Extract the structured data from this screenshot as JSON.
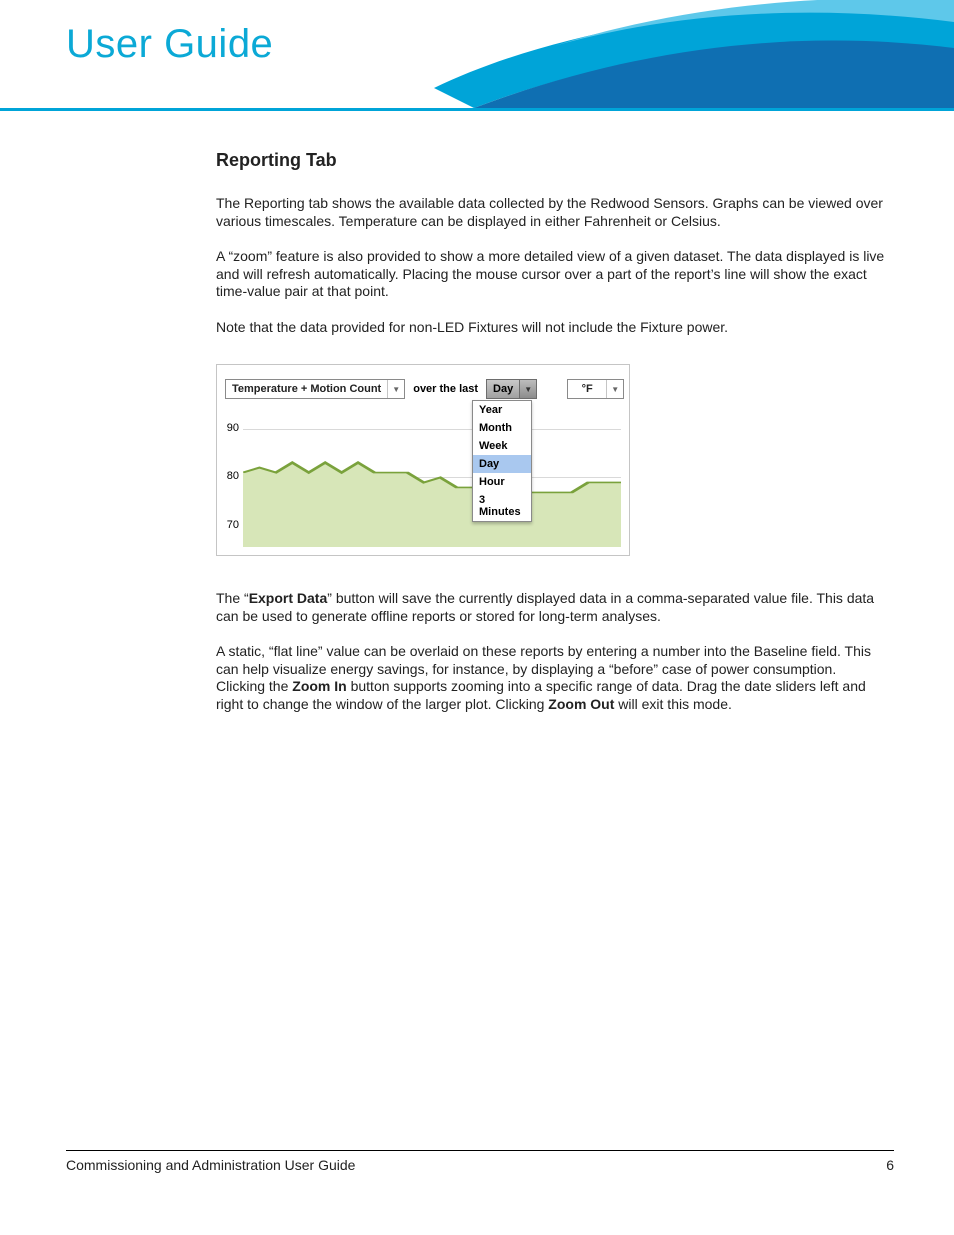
{
  "header": {
    "title": "User Guide"
  },
  "section": {
    "heading": "Reporting Tab"
  },
  "paragraphs": {
    "p1": "The Reporting tab shows the available data collected by the Redwood Sensors. Graphs can be viewed over various timescales. Temperature can be displayed in either Fahrenheit or Celsius.",
    "p2": "A “zoom” feature is also provided to show a more detailed view of a given dataset. The data displayed is live and will refresh automatically. Placing the mouse cursor over a part of the report’s line will show the exact time-value pair at that point.",
    "p3": "Note that the data provided for non-LED Fixtures will not include the Fixture power.",
    "p4_a": "The “",
    "p4_bold": "Export Data",
    "p4_b": "” button will save the currently displayed data in a comma-separated value file. This data can be used to generate offline reports or stored for long-term analyses.",
    "p5_a": "A static, “flat line” value can be overlaid on these reports by entering a number into the Baseline field. This can help visualize energy savings, for instance, by displaying a “before” case of power consumption. Clicking the ",
    "p5_bold1": "Zoom In",
    "p5_b": " button supports zooming into a specific range of data. Drag the date sliders left and right to change the window of the larger plot. Clicking ",
    "p5_bold2": "Zoom Out",
    "p5_c": " will exit this mode."
  },
  "widget": {
    "metric_selected": "Temperature + Motion Count",
    "over_label": "over the last",
    "time_selected": "Day",
    "unit_selected": "°F",
    "time_options": [
      "Year",
      "Month",
      "Week",
      "Day",
      "Hour",
      "3 Minutes"
    ]
  },
  "chart_data": {
    "type": "line",
    "title": "",
    "xlabel": "",
    "ylabel": "",
    "ylim": [
      65,
      92
    ],
    "yticks": [
      70,
      80,
      90
    ],
    "x": [
      0,
      1,
      2,
      3,
      4,
      5,
      6,
      7,
      8,
      9,
      10,
      11,
      12,
      13,
      14,
      15,
      16,
      17,
      18,
      19,
      20,
      21,
      22,
      23
    ],
    "values": [
      80,
      81,
      80,
      82,
      80,
      82,
      80,
      82,
      80,
      80,
      80,
      78,
      79,
      77,
      77,
      76,
      76,
      76,
      76,
      76,
      76,
      78,
      78,
      78
    ]
  },
  "footer": {
    "left": "Commissioning and Administration User Guide",
    "right": "6"
  }
}
